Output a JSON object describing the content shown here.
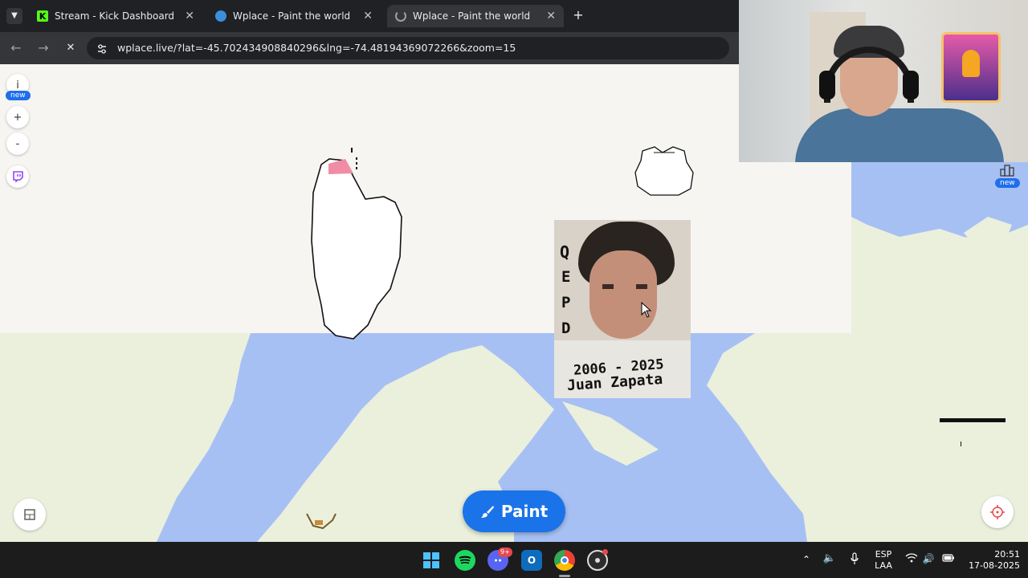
{
  "browser": {
    "tabs": [
      {
        "title": "Stream - Kick Dashboard",
        "favicon": "kick-logo-icon"
      },
      {
        "title": "Wplace - Paint the world",
        "favicon": "globe-icon"
      },
      {
        "title": "Wplace - Paint the world",
        "favicon": "wplace-loading-icon",
        "active": true
      }
    ],
    "new_tab": "+",
    "url": "wplace.live/?lat=-45.702434908840296&lng=-74.48194369072266&zoom=15"
  },
  "map_controls": {
    "info": "i",
    "info_badge": "new",
    "zoom_in": "+",
    "zoom_out": "-",
    "leaderboard_badge": "new"
  },
  "paint_button": {
    "label": "Paint"
  },
  "artwork": {
    "letters": [
      "Q",
      "E",
      "P",
      "D"
    ],
    "years": "2006 - 2025",
    "name": "Juan Zapata"
  },
  "taskbar": {
    "discord_badge": "9+",
    "lang_top": "ESP",
    "lang_bottom": "LAA",
    "time": "20:51",
    "date": "17-08-2025"
  },
  "colors": {
    "accent": "#1a73e8",
    "water": "#a7c0f4",
    "land": "#eaf0dc",
    "canvas": "#f7f5f1",
    "kick_green": "#53fc18"
  }
}
